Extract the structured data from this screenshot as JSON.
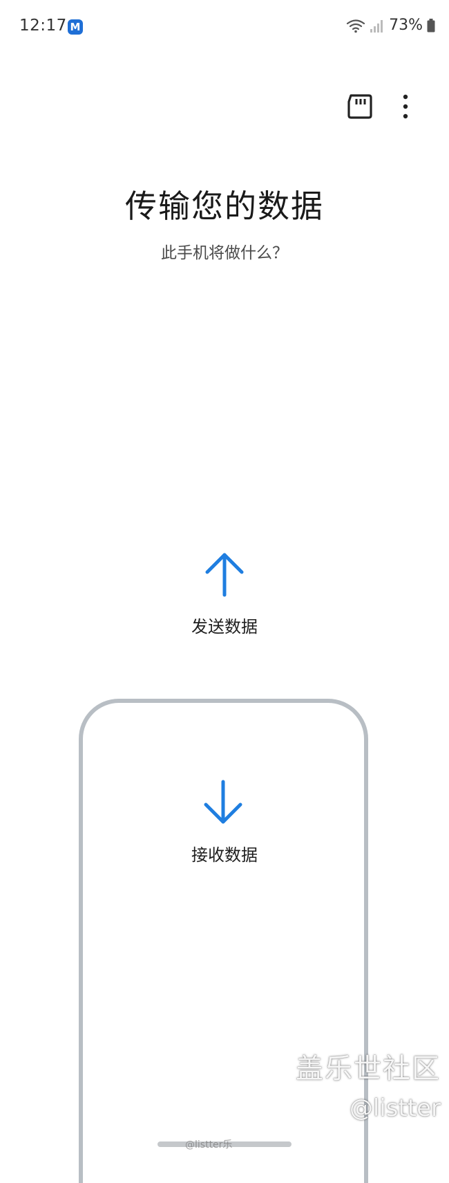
{
  "status_bar": {
    "time": "12:17",
    "app_badge_letter": "M",
    "battery": "73%"
  },
  "header": {
    "title": "传输您的数据",
    "subtitle": "此手机将做什么？"
  },
  "options": {
    "send_label": "发送数据",
    "receive_label": "接收数据"
  },
  "watermark": {
    "brand": "盖乐世社区",
    "handle": "@listter",
    "weibo": "@listter乐"
  },
  "icons": {
    "sd_card": "sd-card-icon",
    "more": "more-vertical-icon",
    "send": "arrow-up-icon",
    "receive": "arrow-down-icon"
  },
  "colors": {
    "accent": "#1f7ee0",
    "card_border": "#b8bec4"
  }
}
